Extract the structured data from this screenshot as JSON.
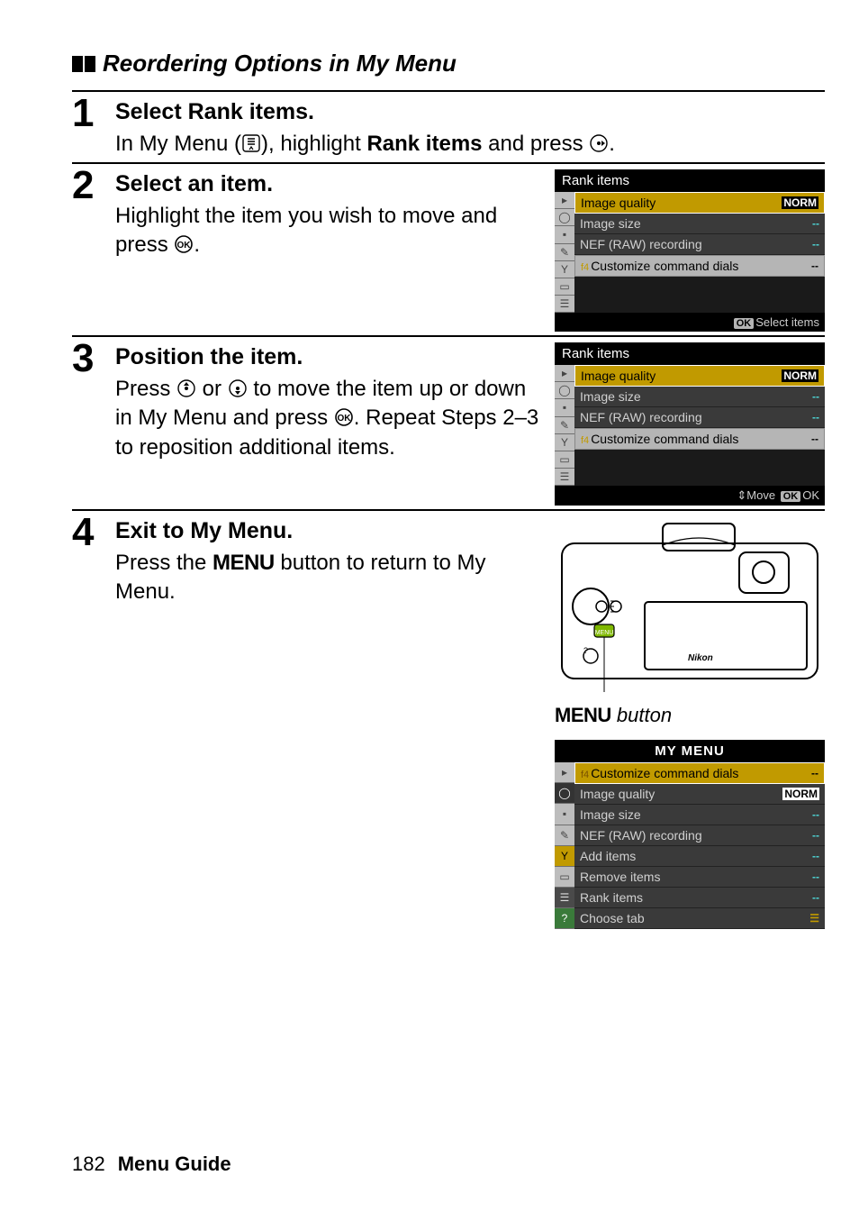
{
  "section_title": "Reordering Options in My Menu",
  "steps": [
    {
      "num": "1",
      "title_prefix": "Select ",
      "title_bold": "Rank items",
      "title_suffix": ".",
      "body_parts": [
        "In My Menu (",
        "), highlight ",
        "Rank items",
        " and press ",
        "."
      ]
    },
    {
      "num": "2",
      "title": "Select an item.",
      "body_parts": [
        "Highlight the item you wish to move and press ",
        "."
      ],
      "lcd": {
        "header": "Rank items",
        "rows": [
          {
            "label": "Image quality",
            "val": "NORM",
            "highlight": true,
            "norm": true
          },
          {
            "label": "Image size",
            "val": "--",
            "cyan": true
          },
          {
            "label": "NEF (RAW) recording",
            "val": "--",
            "cyan": true
          },
          {
            "label": "Customize command dials",
            "val": "--",
            "prefix": "f4",
            "highlight_box": true
          }
        ],
        "footer_prefix": "",
        "footer_ok": "OK",
        "footer_text": "Select items"
      }
    },
    {
      "num": "3",
      "title": "Position the item.",
      "body_parts": [
        "Press ",
        " or ",
        " to move the item up or down in My Menu and press ",
        ". Repeat Steps 2–3 to reposition additional items."
      ],
      "lcd": {
        "header": "Rank items",
        "rows": [
          {
            "label": "Image quality",
            "val": "NORM",
            "highlight": true,
            "norm": true
          },
          {
            "label": "Image size",
            "val": "--",
            "cyan": true
          },
          {
            "label": "NEF (RAW) recording",
            "val": "--",
            "cyan": true
          },
          {
            "label": "Customize command dials",
            "val": "--",
            "prefix": "f4",
            "highlight_box": true
          }
        ],
        "footer_move": "Move ",
        "footer_ok": "OK",
        "footer_text": "OK"
      }
    },
    {
      "num": "4",
      "title": "Exit to My Menu.",
      "body_parts": [
        "Press the ",
        "MENU",
        " button to return to My Menu."
      ],
      "caption_menu": "MENU",
      "caption_rest": " button",
      "lcd": {
        "header": "MY MENU",
        "center": true,
        "rows": [
          {
            "label": "Customize command dials",
            "val": "--",
            "prefix": "f4",
            "highlight": true
          },
          {
            "label": "Image quality",
            "val": "NORM",
            "norm": true
          },
          {
            "label": "Image size",
            "val": "--",
            "cyan": true
          },
          {
            "label": "NEF (RAW) recording",
            "val": "--",
            "cyan": true
          },
          {
            "label": "Add items",
            "val": "--",
            "cyan": true
          },
          {
            "label": "Remove items",
            "val": "--",
            "cyan": true
          },
          {
            "label": "Rank items",
            "val": "--",
            "cyan": true
          },
          {
            "label": "Choose tab",
            "val": "",
            "chooseicon": true
          }
        ]
      }
    }
  ],
  "footer": {
    "page": "182",
    "label": "Menu Guide"
  }
}
